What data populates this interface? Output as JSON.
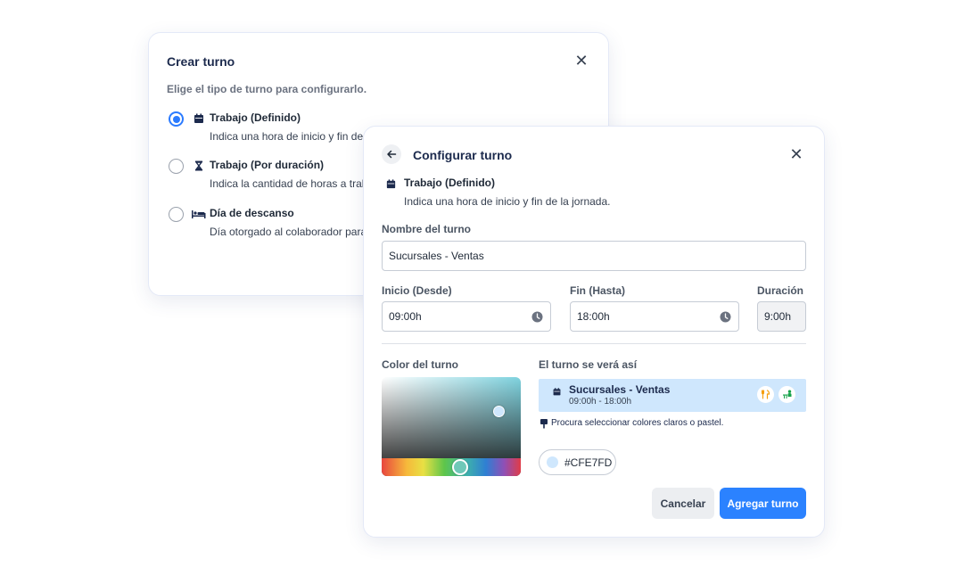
{
  "create_dialog": {
    "title": "Crear turno",
    "close_symbol": "✕",
    "subtitle": "Elige el tipo de turno para configurarlo.",
    "options": [
      {
        "label": "Trabajo (Definido)",
        "description": "Indica una hora de inicio y fin de",
        "icon": "calendar-icon",
        "selected": true
      },
      {
        "label": "Trabajo (Por duración)",
        "description": "Indica la cantidad de horas a trab",
        "icon": "hourglass-icon",
        "selected": false
      },
      {
        "label": "Día de descanso",
        "description": "Día otorgado al colaborador para",
        "icon": "bed-icon",
        "selected": false
      }
    ]
  },
  "config_dialog": {
    "title": "Configurar turno",
    "close_symbol": "✕",
    "type_label": "Trabajo (Definido)",
    "type_description": "Indica una hora de inicio y fin de la jornada.",
    "name_label": "Nombre del turno",
    "name_value": "Sucursales -  Ventas",
    "start_label": "Inicio (Desde)",
    "start_value": "09:00h",
    "end_label": "Fin (Hasta)",
    "end_value": "18:00h",
    "duration_label": "Duración",
    "duration_value": "9:00h",
    "color_label": "Color del turno",
    "preview_label": "El turno se verá así",
    "preview": {
      "name": "Sucursales - Ventas",
      "time": "09:00h - 18:00h",
      "chips": [
        "fork-knife-icon",
        "person-desk-icon"
      ]
    },
    "hint": "Procura seleccionar colores claros o pastel.",
    "hex_value": "#CFE7FD",
    "cancel_label": "Cancelar",
    "submit_label": "Agregar turno"
  },
  "colors": {
    "primary": "#2b82ff",
    "navy": "#1c2a4d",
    "shift_color": "#CFE7FD",
    "chip_orange": "#f59e0b",
    "chip_green": "#16a34a"
  }
}
